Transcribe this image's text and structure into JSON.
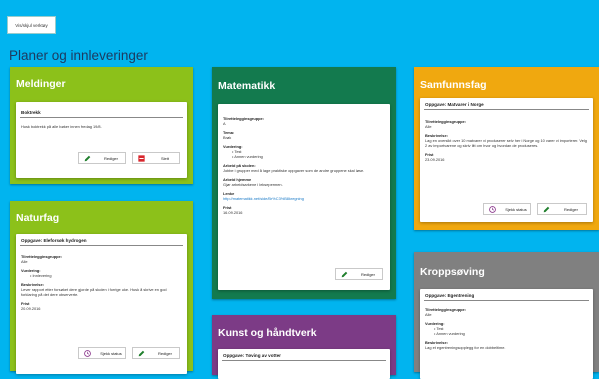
{
  "top_button": "Vis/skjul verktøy",
  "page_title": "Planer og innleveringer",
  "colors": {
    "background": "#01b4ef",
    "green": "#8cc11a",
    "teal": "#137a4e",
    "orange": "#f0a80f",
    "grey": "#808080",
    "purple": "#7c3b86",
    "edit_icon": "#207f2d",
    "delete_icon": "#d8262d",
    "status_icon": "#8c3a8e"
  },
  "meldinger": {
    "title": "Meldinger",
    "card": {
      "heading": "Boktrekk",
      "text": "Husk boktrekk på alle bøker innen fredag 19/8.",
      "edit": "Rediger",
      "delete": "Slett"
    }
  },
  "naturfag": {
    "title": "Naturfag",
    "card": {
      "heading": "Oppgave: Eleforsøk hydrogen",
      "l_group": "Tilrettelegginsgruppe:",
      "v_group": "Alle",
      "l_assess": "Vurdering:",
      "assess": [
        "Innlevering"
      ],
      "l_desc": "Beskrivelse:",
      "v_desc": "Lever rapport etter forsøket dere gjorde på skolen i forrige uke. Husk å skrive en god forklaring på det dere observerte.",
      "l_due": "Frist",
      "v_due": "20.09.2016",
      "status": "Sjekk status",
      "edit": "Rediger"
    }
  },
  "matematikk": {
    "title": "Matematikk",
    "card": {
      "l_group": "Tilrettelegginsgruppe:",
      "v_group": "A",
      "l_theme": "Tema:",
      "v_theme": "Brøk",
      "l_assess": "Vurdering:",
      "assess": [
        "Test",
        "Annen vurdering"
      ],
      "l_school": "Arbeid på skolen:",
      "v_school": "Jobbe i grupper med å lage praktiske oppgaver som de andre gruppene skal løse.",
      "l_home": "Arbeid hjemme",
      "v_home": "Gjør arbeidsarkene i leksepermen.",
      "l_link": "Lenke",
      "v_link": "http://matematikk.net/side/Br%C3%B8kregning",
      "l_due": "Frist",
      "v_due": "16.09.2016",
      "edit": "Rediger"
    }
  },
  "samfunnsfag": {
    "title": "Samfunnsfag",
    "card": {
      "heading": "Oppgave: Matvarer i Norge",
      "l_group": "Tilrettelegginsgruppe:",
      "v_group": "Alle",
      "l_desc": "Beskrivelse:",
      "v_desc": "Lag en oversikt over 10 matvarer vi produserer selv her i Norge og 10 varer vi importerer. Velg 2 av importvarene og skriv litt om hvor og hvordan de produseres.",
      "l_due": "Frist",
      "v_due": "23.09.2016",
      "status": "Sjekk status",
      "edit": "Rediger"
    }
  },
  "kroppsoving": {
    "title": "Kroppsøving",
    "card": {
      "heading": "Oppgave: Egentrening",
      "l_group": "Tilrettelegginsgruppe:",
      "v_group": "Alle",
      "l_assess": "Vurdering:",
      "assess": [
        "Test",
        "Annen vurdering"
      ],
      "l_desc": "Beskrivelse:",
      "v_desc": "Lag et egentreningsopplegg for en dobbeltime."
    }
  },
  "kunst": {
    "title": "Kunst og håndtverk",
    "card": {
      "heading": "Oppgave: Tøving av votter"
    }
  }
}
